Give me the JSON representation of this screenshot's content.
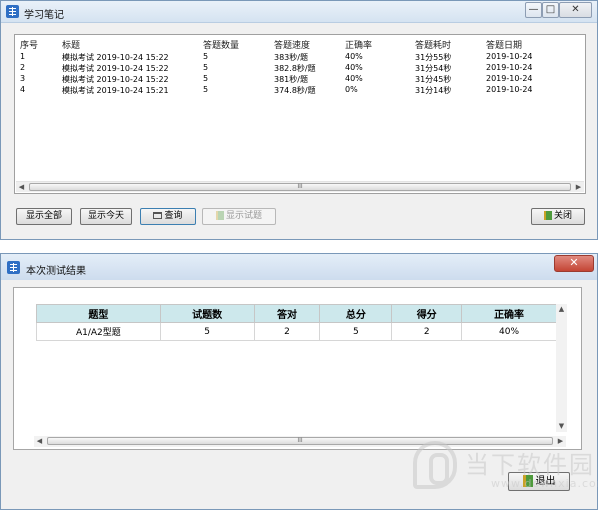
{
  "window1": {
    "title": "学习笔记",
    "columns": [
      "序号",
      "标题",
      "答题数量",
      "答题速度",
      "正确率",
      "答题耗时",
      "答题日期"
    ],
    "rows": [
      [
        "1",
        "模拟考试 2019-10-24 15:22",
        "5",
        "383秒/题",
        "40%",
        "31分55秒",
        "2019-10-24"
      ],
      [
        "2",
        "模拟考试 2019-10-24 15:22",
        "5",
        "382.8秒/题",
        "40%",
        "31分54秒",
        "2019-10-24"
      ],
      [
        "3",
        "模拟考试 2019-10-24 15:22",
        "5",
        "381秒/题",
        "40%",
        "31分45秒",
        "2019-10-24"
      ],
      [
        "4",
        "模拟考试 2019-10-24 15:21",
        "5",
        "374.8秒/题",
        "0%",
        "31分14秒",
        "2019-10-24"
      ]
    ],
    "buttons": {
      "show_all": "显示全部",
      "show_today": "显示今天",
      "query": "查询",
      "show_questions": "显示试题",
      "close": "关闭"
    },
    "scroll_grip": "III",
    "controls": {
      "minimize": "—",
      "maximize": "□",
      "close": "✕"
    }
  },
  "window2": {
    "title": "本次测试结果",
    "columns": [
      "题型",
      "试题数",
      "答对",
      "总分",
      "得分",
      "正确率"
    ],
    "row": [
      "A1/A2型题",
      "5",
      "2",
      "5",
      "2",
      "40%"
    ],
    "exit": "退出",
    "scroll_grip": "III",
    "close": "✕"
  },
  "watermark": {
    "brand": "当下软件园",
    "url": "www.downxia.com"
  }
}
